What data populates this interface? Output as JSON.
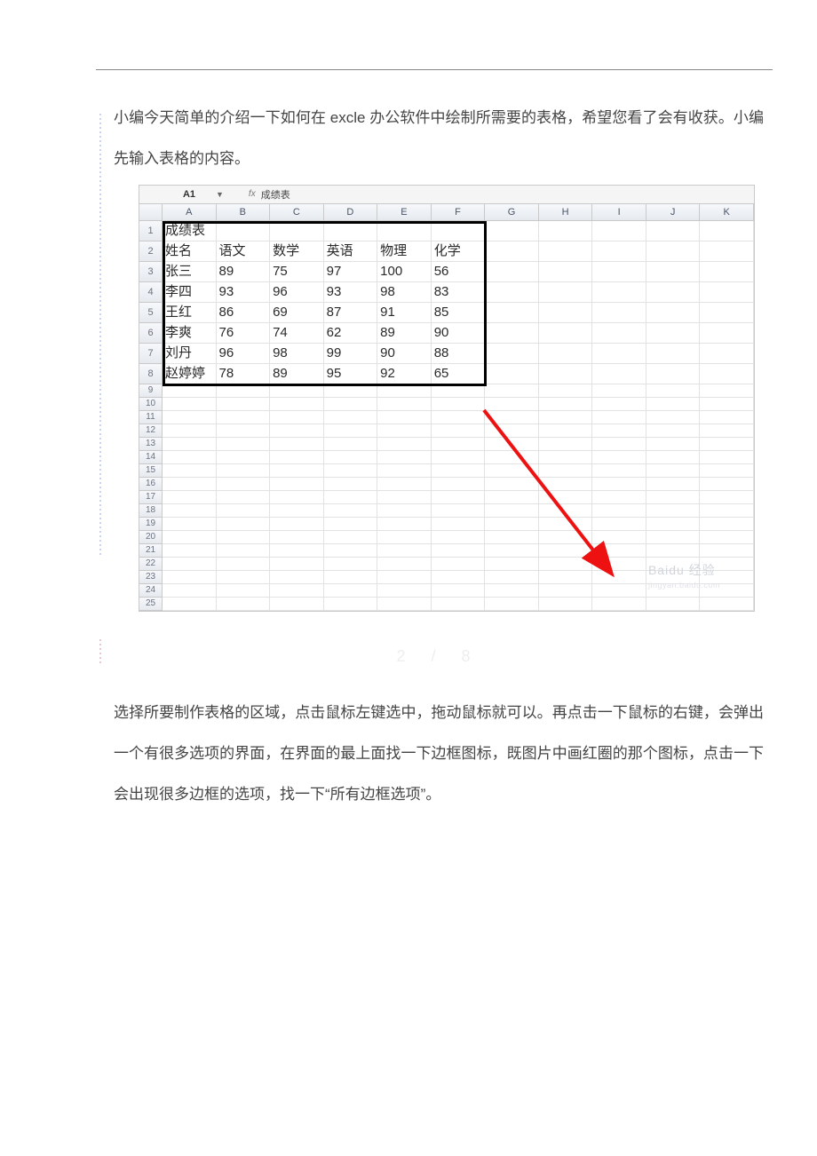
{
  "intro_paragraph": "小编今天简单的介绍一下如何在 excle 办公软件中绘制所需要的表格，希望您看了会有收获。小编先输入表格的内容。",
  "spreadsheet": {
    "active_cell_ref": "A1",
    "formula_bar_label": "fx",
    "formula_bar_value": "成绩表",
    "column_letters": [
      "A",
      "B",
      "C",
      "D",
      "E",
      "F",
      "G",
      "H",
      "I",
      "J",
      "K"
    ],
    "row_numbers": [
      1,
      2,
      3,
      4,
      5,
      6,
      7,
      8,
      9,
      10,
      11,
      12,
      13,
      14,
      15,
      16,
      17,
      18,
      19,
      20,
      21,
      22,
      23,
      24,
      25
    ],
    "title_cell": "成绩表",
    "header_row": [
      "姓名",
      "语文",
      "数学",
      "英语",
      "物理",
      "化学"
    ],
    "rows": [
      {
        "name": "张三",
        "scores": [
          89,
          75,
          97,
          100,
          56
        ]
      },
      {
        "name": "李四",
        "scores": [
          93,
          96,
          93,
          98,
          83
        ]
      },
      {
        "name": "王红",
        "scores": [
          86,
          69,
          87,
          91,
          85
        ]
      },
      {
        "name": "李爽",
        "scores": [
          76,
          74,
          62,
          89,
          90
        ]
      },
      {
        "name": "刘丹",
        "scores": [
          96,
          98,
          99,
          90,
          88
        ]
      },
      {
        "name": "赵婷婷",
        "scores": [
          78,
          89,
          95,
          92,
          65
        ]
      }
    ],
    "watermark_main": "Baidu 经验",
    "watermark_sub": "jingyan.baidu.com"
  },
  "pager_text": "2 / 8",
  "step_paragraph": "选择所要制作表格的区域，点击鼠标左键选中，拖动鼠标就可以。再点击一下鼠标的右键，会弹出一个有很多选项的界面，在界面的最上面找一下边框图标，既图片中画红圈的那个图标，点击一下会出现很多边框的选项，找一下“所有边框选项”。"
}
